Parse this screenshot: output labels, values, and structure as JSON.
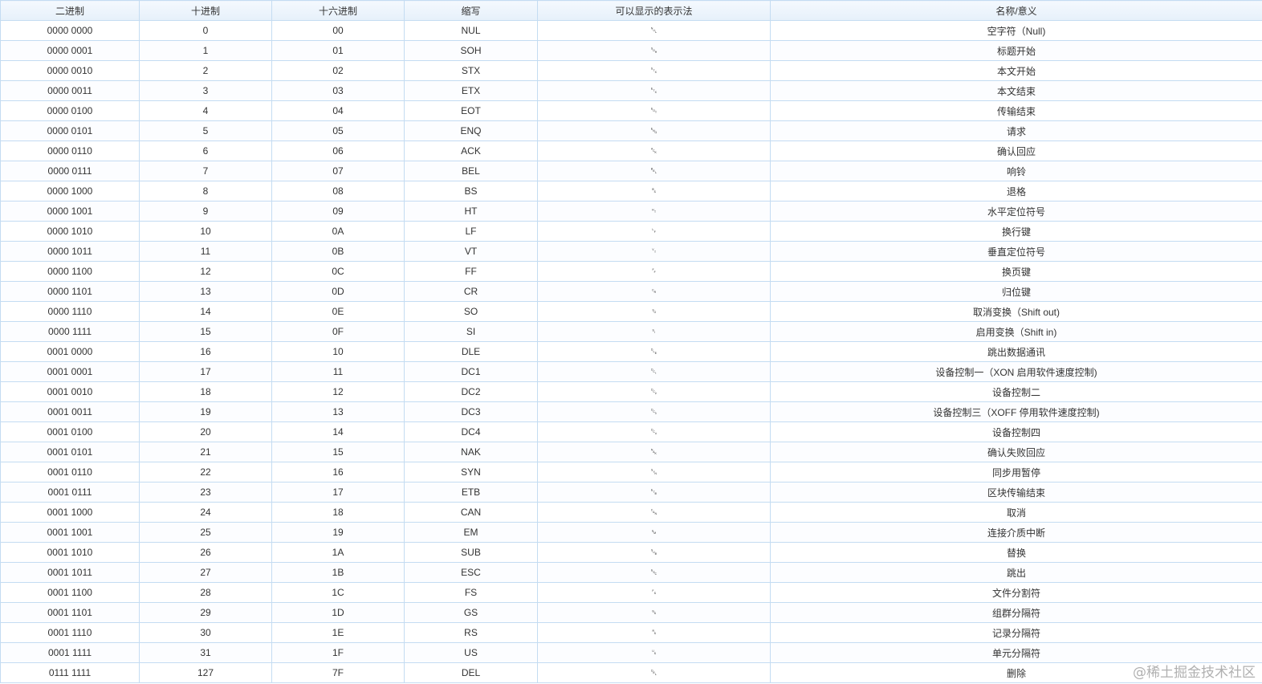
{
  "headers": [
    "二进制",
    "十进制",
    "十六进制",
    "缩写",
    "可以显示的表示法",
    "名称/意义"
  ],
  "rows": [
    [
      "0000 0000",
      "0",
      "00",
      "NUL",
      "␀",
      "空字符（Null)"
    ],
    [
      "0000 0001",
      "1",
      "01",
      "SOH",
      "␁",
      "标题开始"
    ],
    [
      "0000 0010",
      "2",
      "02",
      "STX",
      "␂",
      "本文开始"
    ],
    [
      "0000 0011",
      "3",
      "03",
      "ETX",
      "␃",
      "本文结束"
    ],
    [
      "0000 0100",
      "4",
      "04",
      "EOT",
      "␄",
      "传输结束"
    ],
    [
      "0000 0101",
      "5",
      "05",
      "ENQ",
      "␅",
      "请求"
    ],
    [
      "0000 0110",
      "6",
      "06",
      "ACK",
      "␆",
      "确认回应"
    ],
    [
      "0000 0111",
      "7",
      "07",
      "BEL",
      "␇",
      "响铃"
    ],
    [
      "0000 1000",
      "8",
      "08",
      "BS",
      "␈",
      "退格"
    ],
    [
      "0000 1001",
      "9",
      "09",
      "HT",
      "␉",
      "水平定位符号"
    ],
    [
      "0000 1010",
      "10",
      "0A",
      "LF",
      "␊",
      "换行键"
    ],
    [
      "0000 1011",
      "11",
      "0B",
      "VT",
      "␋",
      "垂直定位符号"
    ],
    [
      "0000 1100",
      "12",
      "0C",
      "FF",
      "␌",
      "换页键"
    ],
    [
      "0000 1101",
      "13",
      "0D",
      "CR",
      "␍",
      "归位键"
    ],
    [
      "0000 1110",
      "14",
      "0E",
      "SO",
      "␎",
      "取消变换（Shift out)"
    ],
    [
      "0000 1111",
      "15",
      "0F",
      "SI",
      "␏",
      "启用变换（Shift in)"
    ],
    [
      "0001 0000",
      "16",
      "10",
      "DLE",
      "␐",
      "跳出数据通讯"
    ],
    [
      "0001 0001",
      "17",
      "11",
      "DC1",
      "␑",
      "设备控制一（XON 启用软件速度控制)"
    ],
    [
      "0001 0010",
      "18",
      "12",
      "DC2",
      "␒",
      "设备控制二"
    ],
    [
      "0001 0011",
      "19",
      "13",
      "DC3",
      "␓",
      "设备控制三（XOFF 停用软件速度控制)"
    ],
    [
      "0001 0100",
      "20",
      "14",
      "DC4",
      "␔",
      "设备控制四"
    ],
    [
      "0001 0101",
      "21",
      "15",
      "NAK",
      "␕",
      "确认失败回应"
    ],
    [
      "0001 0110",
      "22",
      "16",
      "SYN",
      "␖",
      "同步用暂停"
    ],
    [
      "0001 0111",
      "23",
      "17",
      "ETB",
      "␗",
      "区块传输结束"
    ],
    [
      "0001 1000",
      "24",
      "18",
      "CAN",
      "␘",
      "取消"
    ],
    [
      "0001 1001",
      "25",
      "19",
      "EM",
      "␙",
      "连接介质中断"
    ],
    [
      "0001 1010",
      "26",
      "1A",
      "SUB",
      "␚",
      "替换"
    ],
    [
      "0001 1011",
      "27",
      "1B",
      "ESC",
      "␛",
      "跳出"
    ],
    [
      "0001 1100",
      "28",
      "1C",
      "FS",
      "␜",
      "文件分割符"
    ],
    [
      "0001 1101",
      "29",
      "1D",
      "GS",
      "␝",
      "组群分隔符"
    ],
    [
      "0001 1110",
      "30",
      "1E",
      "RS",
      "␞",
      "记录分隔符"
    ],
    [
      "0001 1111",
      "31",
      "1F",
      "US",
      "␟",
      "单元分隔符"
    ],
    [
      "0111 1111",
      "127",
      "7F",
      "DEL",
      "␡",
      "删除"
    ]
  ],
  "watermark": "@稀土掘金技术社区"
}
